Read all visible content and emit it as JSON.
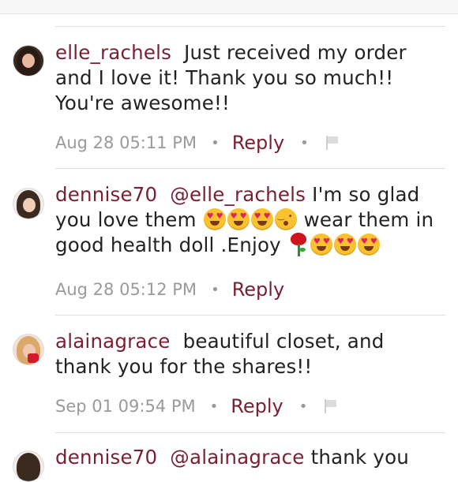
{
  "comments": [
    {
      "username": "elle_rachels",
      "text": "Just received my order and I love it! Thank you so much!! You're awesome!!",
      "timestamp": "Aug 28 05:11 PM",
      "reply_label": "Reply",
      "has_flag": true
    },
    {
      "username": "dennise70",
      "mention": "@elle_rachels",
      "text_part1": "I'm so glad you love them",
      "text_part2": "wear them in good health doll .Enjoy",
      "timestamp": "Aug 28 05:12 PM",
      "reply_label": "Reply",
      "has_flag": false
    },
    {
      "username": "alainagrace",
      "text": "beautiful closet, and thank you for the shares!!",
      "timestamp": "Sep 01 09:54 PM",
      "reply_label": "Reply",
      "has_flag": true
    },
    {
      "username": "dennise70",
      "mention": "@alainagrace",
      "text": "thank you"
    }
  ],
  "colors": {
    "username": "#7a1f33",
    "reply": "#7a1f33",
    "timestamp": "#9a9a9a",
    "divider": "#dedede"
  },
  "icons": [
    "flag-icon",
    "heart-eyes-emoji",
    "kiss-emoji",
    "rose-emoji"
  ]
}
